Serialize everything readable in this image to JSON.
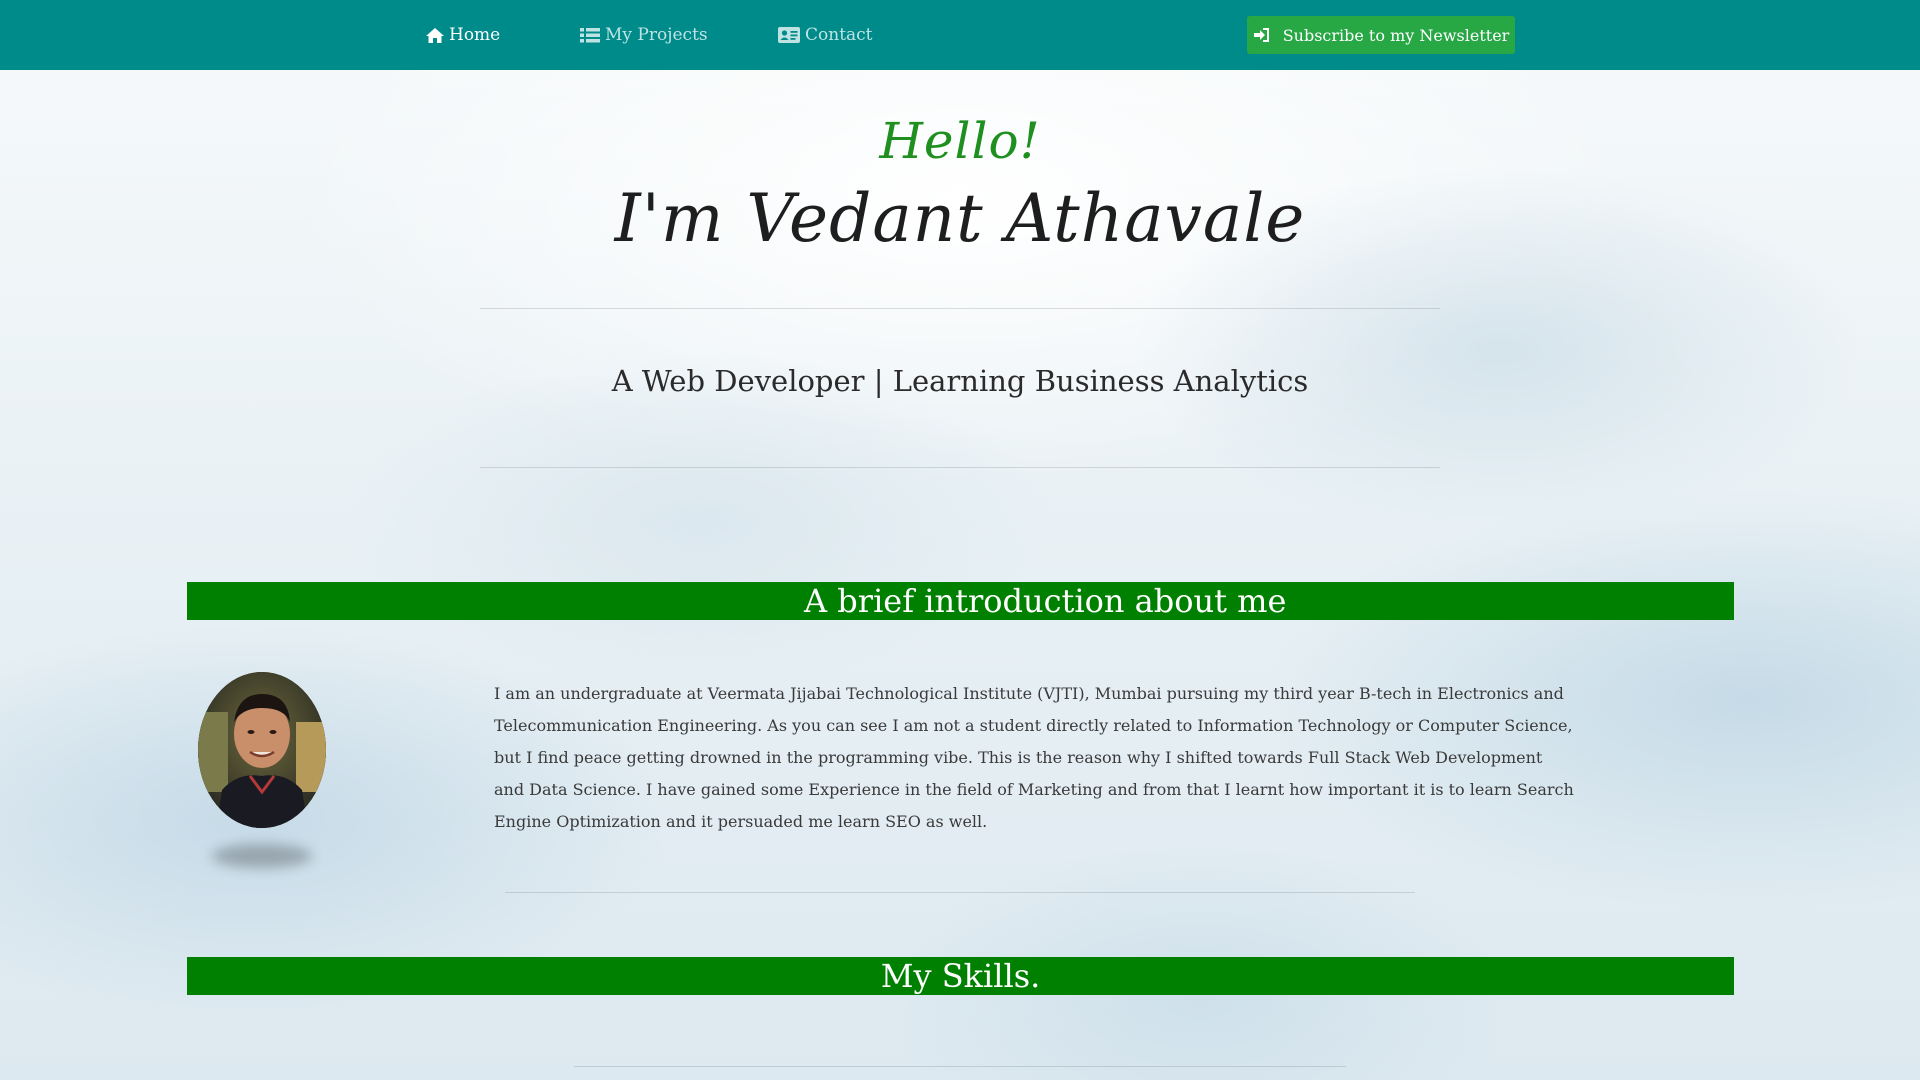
{
  "nav": {
    "home": "Home",
    "projects": "My Projects",
    "contact": "Contact",
    "subscribe": "Subscribe to my Newsletter"
  },
  "colors": {
    "navbar": "#008b8b",
    "subscribe_button": "#28a745",
    "section_bar": "#008000",
    "hello_text": "#1f8f1f"
  },
  "icons": {
    "home": "home-icon",
    "projects": "list-icon",
    "contact": "contact-card-icon",
    "subscribe": "sign-in-icon"
  },
  "hero": {
    "greeting": "Hello!",
    "name": "I'm Vedant Athavale",
    "tagline": "A Web Developer | Learning Business Analytics"
  },
  "intro": {
    "heading": "A brief introduction about me",
    "paragraph": "I am an undergraduate at Veermata Jijabai Technological Institute (VJTI), Mumbai pursuing my third year B-tech in Electronics and Telecommunication Engineering. As you can see I am not a student directly related to Information Technology or Computer Science, but I find peace getting drowned in the programming vibe. This is the reason why I shifted towards Full Stack Web Development and Data Science. I have gained some Experience in the field of Marketing and from that I learnt how important it is to learn Search Engine Optimization and it persuaded me learn SEO as well."
  },
  "skills": {
    "heading": "My Skills."
  }
}
